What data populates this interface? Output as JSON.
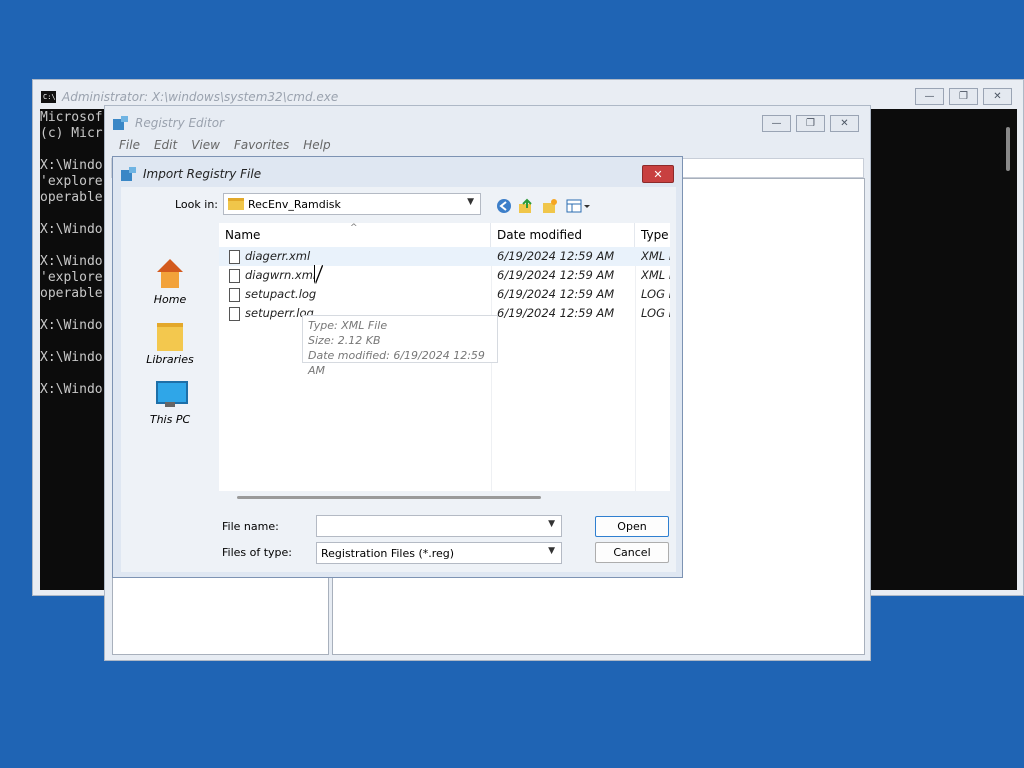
{
  "cmd": {
    "title": "Administrator: X:\\windows\\system32\\cmd.exe",
    "icon_text": "C:\\",
    "lines": [
      "Microsof",
      "(c) Micr",
      "",
      "X:\\Windo",
      "'explore",
      "operable",
      "",
      "X:\\Windo",
      "",
      "X:\\Windo",
      "'explore",
      "operable",
      "",
      "X:\\Windo",
      "",
      "X:\\Windo",
      "",
      "X:\\Windo"
    ],
    "btn_min": "—",
    "btn_max": "❐",
    "btn_close": "✕"
  },
  "registry": {
    "title": "Registry Editor",
    "menu": [
      "File",
      "Edit",
      "View",
      "Favorites",
      "Help"
    ],
    "btn_min": "—",
    "btn_max": "❐",
    "btn_close": "✕"
  },
  "dialog": {
    "title": "Import Registry File",
    "close": "✕",
    "lookin_label": "Look in:",
    "lookin_value": "RecEnv_Ramdisk",
    "places": [
      "Home",
      "Libraries",
      "This PC"
    ],
    "columns": [
      "Name",
      "Date modified",
      "Type"
    ],
    "files": [
      {
        "name": "diagerr.xml",
        "date": "6/19/2024 12:59 AM",
        "type": "XML File"
      },
      {
        "name": "diagwrn.xml",
        "date": "6/19/2024 12:59 AM",
        "type": "XML File"
      },
      {
        "name": "setupact.log",
        "date": "6/19/2024 12:59 AM",
        "type": "LOG File"
      },
      {
        "name": "setuperr.log",
        "date": "6/19/2024 12:59 AM",
        "type": "LOG File"
      }
    ],
    "tooltip": [
      "Type: XML File",
      "Size: 2.12 KB",
      "Date modified: 6/19/2024 12:59 AM"
    ],
    "filename_label": "File name:",
    "filename_value": "",
    "filetype_label": "Files of type:",
    "filetype_value": "Registration Files (*.reg)",
    "open_label": "Open",
    "cancel_label": "Cancel"
  }
}
